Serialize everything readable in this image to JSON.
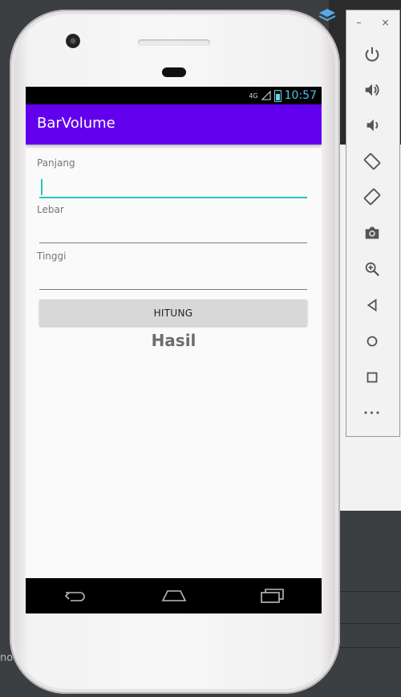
{
  "app": {
    "title": "BarVolume",
    "accent_color": "#6200ee",
    "cursor_color": "#26c6c0"
  },
  "statusbar": {
    "network": "4G",
    "time": "10:57"
  },
  "form": {
    "panjang_label": "Panjang",
    "panjang_value": "",
    "lebar_label": "Lebar",
    "lebar_value": "",
    "tinggi_label": "Tinggi",
    "tinggi_value": ""
  },
  "button": {
    "hitung_label": "HITUNG"
  },
  "result": {
    "text": "Hasil"
  },
  "emulator_panel": {
    "minimize": "–",
    "close": "×",
    "tools": [
      "power-icon",
      "volume-up-icon",
      "volume-down-icon",
      "rotate-left-icon",
      "rotate-right-icon",
      "camera-icon",
      "zoom-icon",
      "back-icon",
      "home-icon",
      "overview-icon",
      "more-icon"
    ],
    "more": "•••"
  },
  "ide": {
    "partial_text": "no"
  }
}
